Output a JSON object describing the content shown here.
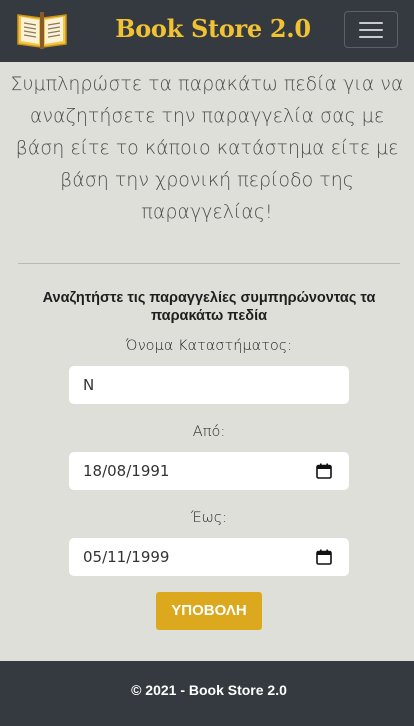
{
  "navbar": {
    "brand": "Book Store 2.0",
    "logo_icon": "open-book-icon",
    "toggler_icon": "hamburger-menu-icon",
    "background": "#343a40",
    "brand_color": "#f1c232"
  },
  "intro_text": "Συμπληρώστε τα παρακάτω πεδία για να αναζητήσετε την παραγγελία σας με βάση είτε το κάποιο κατάστημα είτε με βάση την χρονική περίοδο της παραγγελίας!",
  "form": {
    "title": "Αναζητήστε τις παραγγελίες συμπηρώνοντας τα παρακάτω πεδία",
    "store_label": "Όνομα Καταστήματος:",
    "store_value": "N",
    "from_label": "Από:",
    "from_value": "18/08/1991",
    "to_label": "Έως:",
    "to_value": "05/11/1999",
    "calendar_icon": "calendar-icon",
    "submit_label": "ΥΠΟΒΟΛΗ",
    "submit_color": "#dca81d"
  },
  "footer": {
    "text": "© 2021 - Book Store 2.0"
  },
  "page_background": "#dfdfd9"
}
